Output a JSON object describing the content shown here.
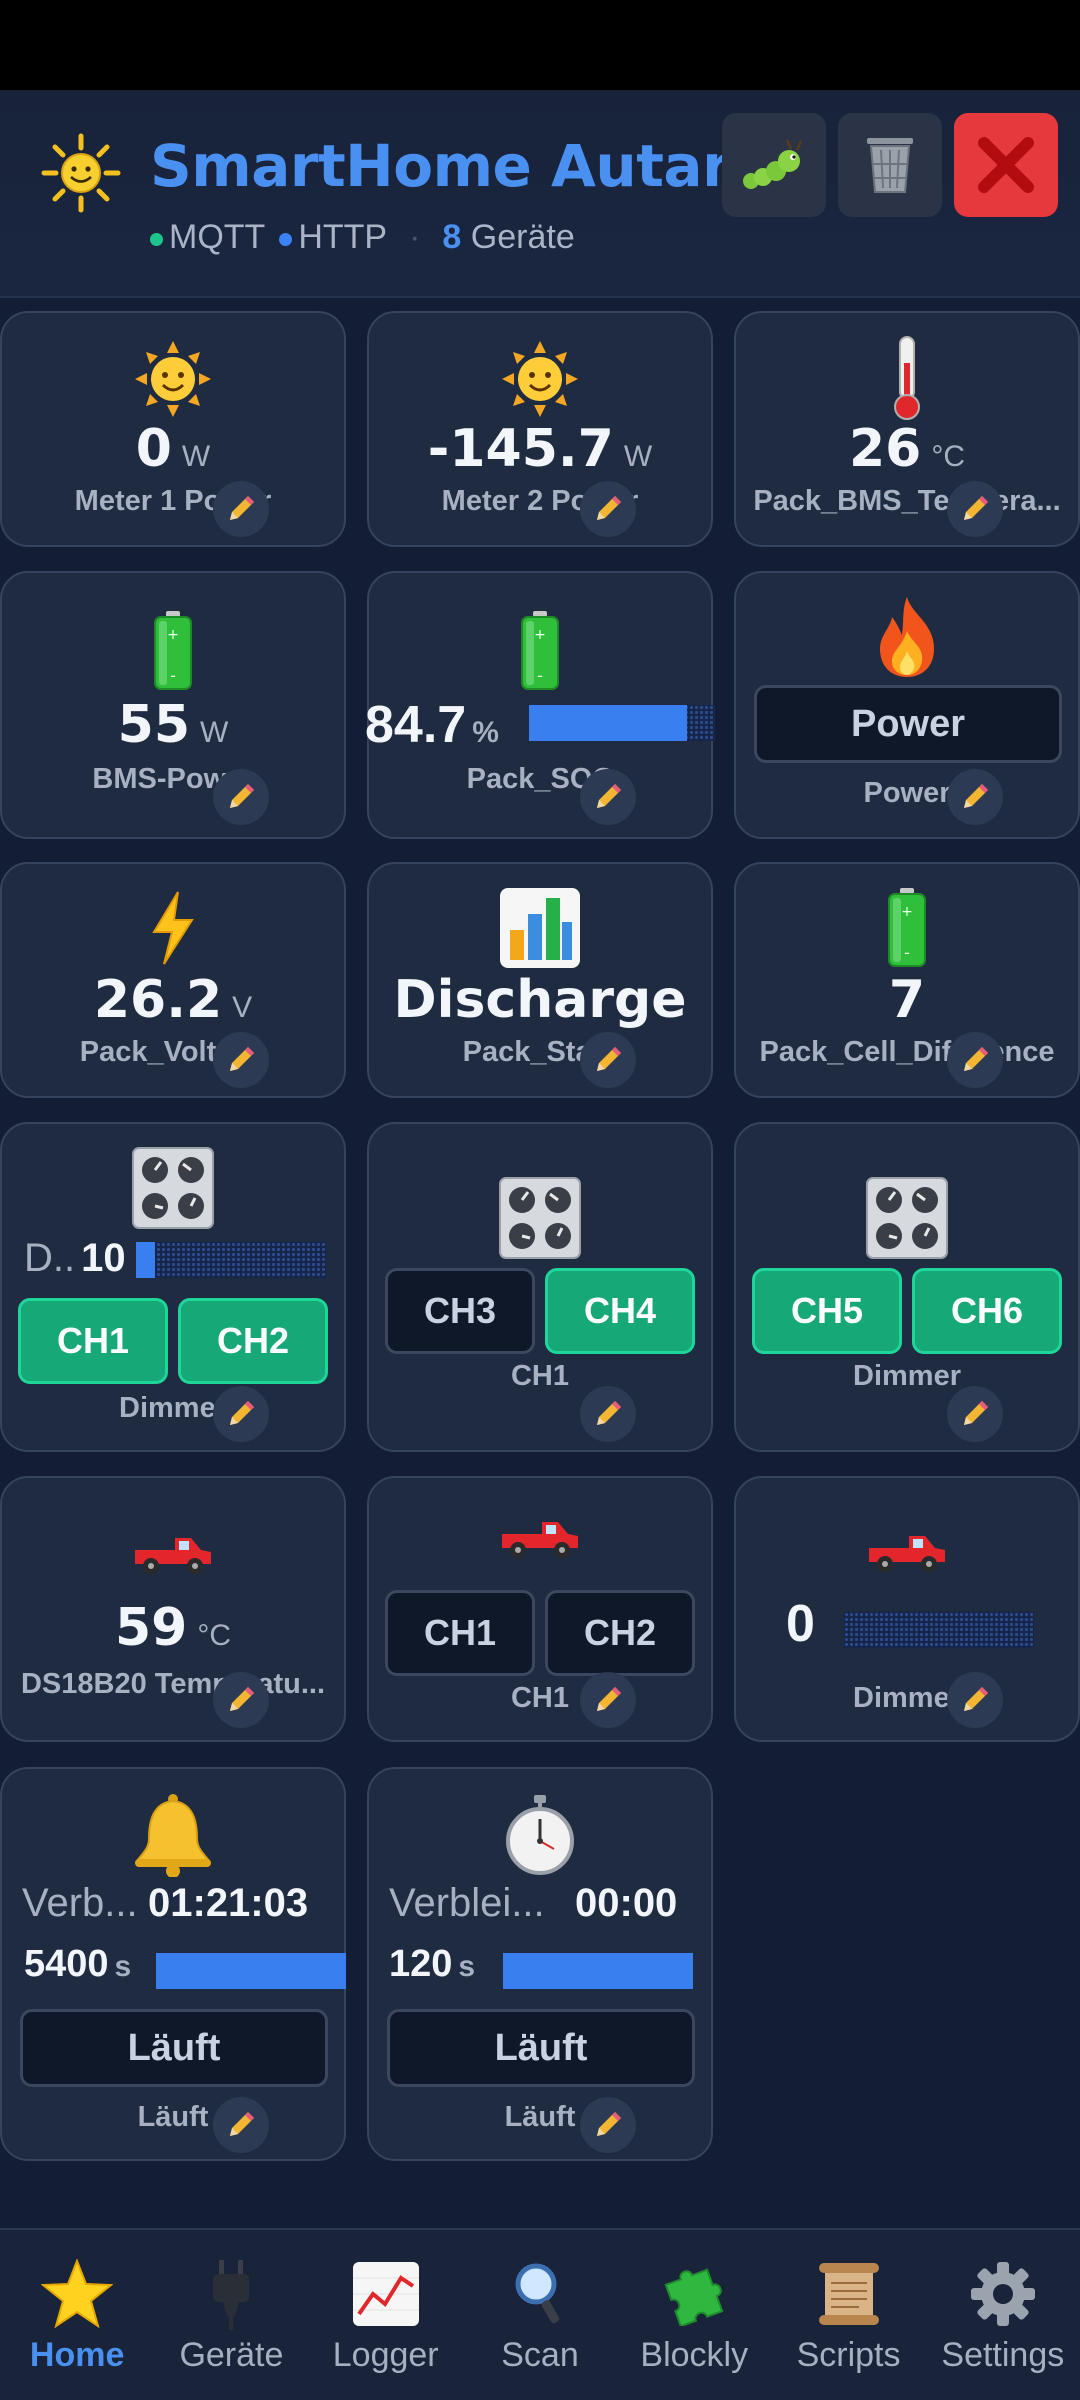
{
  "header": {
    "title": "SmartHome Autark",
    "status_mqtt": "MQTT",
    "status_http": "HTTP",
    "separator": "·",
    "device_count": "8",
    "device_label": "Geräte"
  },
  "cards": {
    "meter1": {
      "value": "0",
      "unit": "W",
      "label": "Meter 1 Power"
    },
    "meter2": {
      "value": "-145.7",
      "unit": "W",
      "label": "Meter 2 Power"
    },
    "bms_temp": {
      "value": "26",
      "unit": "°C",
      "label": "Pack_BMS_Tempera..."
    },
    "bms_power": {
      "value": "55",
      "unit": "W",
      "label": "BMS-Power"
    },
    "pack_soc": {
      "value": "84.7",
      "unit": "%",
      "label": "Pack_SOC",
      "level": 0.847
    },
    "power": {
      "button": "Power",
      "label": "Power"
    },
    "pack_volt": {
      "value": "26.2",
      "unit": "V",
      "label": "Pack_Voltage"
    },
    "pack_state": {
      "value": "Discharge",
      "label": "Pack_State"
    },
    "cell_diff": {
      "value": "7",
      "label": "Pack_Cell_Difference"
    },
    "dimmer1": {
      "prefix": "D..",
      "value": "10",
      "level": 0.1,
      "ch_a": "CH1",
      "ch_b": "CH2",
      "label": "Dimmer"
    },
    "dimmer2": {
      "ch_a": "CH3",
      "ch_b": "CH4",
      "label": "CH1"
    },
    "dimmer3": {
      "ch_a": "CH5",
      "ch_b": "CH6",
      "label": "Dimmer"
    },
    "ds18b20": {
      "value": "59",
      "unit": "°C",
      "label": "DS18B20 Temperatu..."
    },
    "truck_relay": {
      "ch_a": "CH1",
      "ch_b": "CH2",
      "label": "CH1"
    },
    "truck_dimmer": {
      "value": "0",
      "level": 0,
      "label": "Dimmer"
    },
    "timer1": {
      "rem_label": "Verb...",
      "rem_value": "01:21:03",
      "seconds": "5400",
      "unit": "s",
      "level": 1.0,
      "button": "Läuft",
      "label": "Läuft"
    },
    "timer2": {
      "rem_label": "Verblei...",
      "rem_value": "00:00",
      "seconds": "120",
      "unit": "s",
      "level": 1.0,
      "button": "Läuft",
      "label": "Läuft"
    }
  },
  "nav": [
    {
      "label": "Home",
      "icon": "star-icon"
    },
    {
      "label": "Geräte",
      "icon": "plug-icon"
    },
    {
      "label": "Logger",
      "icon": "chart-icon"
    },
    {
      "label": "Scan",
      "icon": "magnifier-icon"
    },
    {
      "label": "Blockly",
      "icon": "puzzle-icon"
    },
    {
      "label": "Scripts",
      "icon": "scroll-icon"
    },
    {
      "label": "Settings",
      "icon": "gear-icon"
    }
  ],
  "colors": {
    "accent": "#4a90f0",
    "on": "#16a876",
    "close": "#e5393d"
  }
}
